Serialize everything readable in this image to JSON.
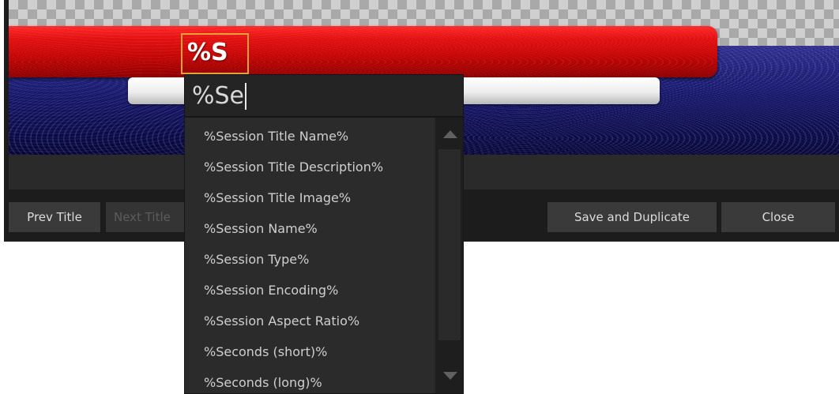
{
  "canvas": {
    "title_text": "%S",
    "colors": {
      "red_bar": "#e31111",
      "blue_panel": "#14146a",
      "selection_border": "#e2a23a"
    }
  },
  "autocomplete": {
    "query": "%Se",
    "items": [
      "%Session Title Name%",
      "%Session Title Description%",
      "%Session Title Image%",
      "%Session Name%",
      "%Session Type%",
      "%Session Encoding%",
      "%Session Aspect Ratio%",
      "%Seconds (short)%",
      "%Seconds (long)%"
    ],
    "scrollbar": {
      "up_icon": "triangle-up-icon",
      "down_icon": "triangle-down-icon"
    }
  },
  "buttons": {
    "prev_title": "Prev Title",
    "next_title": "Next Title",
    "save_duplicate": "Save and Duplicate",
    "close": "Close"
  }
}
